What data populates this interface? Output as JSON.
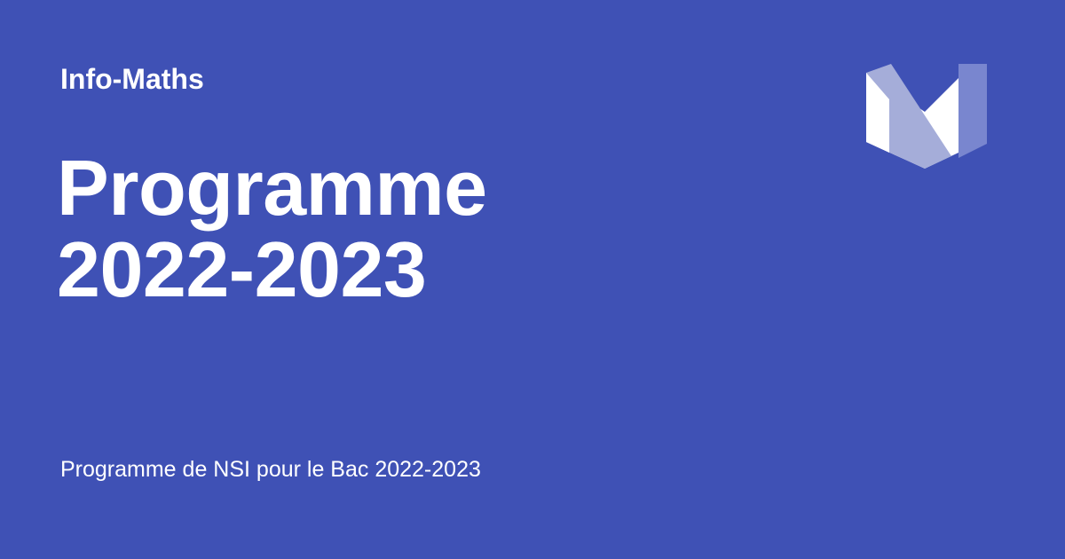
{
  "card": {
    "site_name": "Info-Maths",
    "title_lines": [
      "Programme",
      "2022-2023"
    ],
    "description": "Programme de NSI pour le Bac 2022-2023"
  },
  "logo": {
    "icon": "material-logo-icon",
    "colors": {
      "white": "#ffffff",
      "light": "#a5add9",
      "mid": "#7986cf"
    }
  },
  "colors": {
    "background": "#3f51b5",
    "text": "#ffffff"
  }
}
